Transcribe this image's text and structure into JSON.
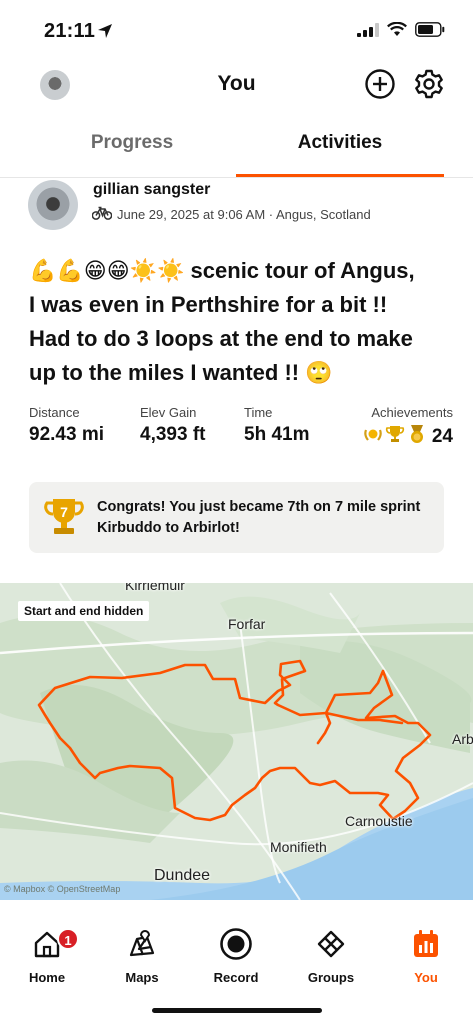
{
  "status": {
    "time": "21:11"
  },
  "header": {
    "title": "You"
  },
  "tabs": {
    "progress": "Progress",
    "activities": "Activities"
  },
  "activity": {
    "athlete": "gillian sangster",
    "meta": "June 29, 2025 at 9:06 AM · Angus, Scotland",
    "title_lines": [
      "💪💪😁😁☀️☀️ scenic tour of Angus,",
      "I was even in Perthshire for a bit !!",
      "Had to do 3 loops at the end to make",
      "up to the miles I wanted !! 🙄"
    ],
    "stats": {
      "distance_label": "Distance",
      "distance_value": "92.43 mi",
      "elev_label": "Elev Gain",
      "elev_value": "4,393 ft",
      "time_label": "Time",
      "time_value": "5h 41m",
      "ach_label": "Achievements",
      "ach_value": "24"
    },
    "congrats": {
      "rank": "7",
      "text": "Congrats! You just became 7th on 7 mile sprint Kirbuddo to Arbirlot!"
    }
  },
  "map": {
    "badge": "Start and end hidden",
    "labels": [
      "Kirriemuir",
      "Forfar",
      "Arb",
      "Carnoustie",
      "Monifieth",
      "Dundee"
    ],
    "credit": "© Mapbox © OpenStreetMap"
  },
  "tabbar": {
    "home": "Home",
    "maps": "Maps",
    "record": "Record",
    "groups": "Groups",
    "you": "You",
    "home_badge": "1"
  },
  "colors": {
    "accent": "#fc5200",
    "badge": "#d81f26",
    "route": "#fc5200"
  },
  "icons": [
    "location-arrow-icon",
    "signal-icon",
    "wifi-icon",
    "battery-icon",
    "plus-icon",
    "gear-icon",
    "bike-icon",
    "trophy-icon",
    "home-icon",
    "maps-icon",
    "record-icon",
    "groups-icon",
    "you-icon"
  ]
}
